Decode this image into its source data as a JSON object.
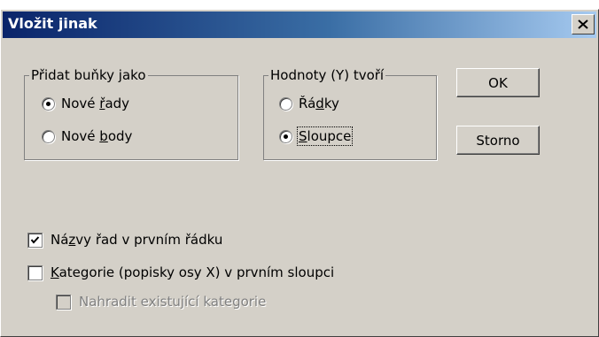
{
  "dialog": {
    "title": "Vložit jinak",
    "close_icon": "close-icon"
  },
  "add_cells_group": {
    "legend": "Přidat buňky jako",
    "options": [
      {
        "label_pre": "Nové ",
        "label_mn": "ř",
        "label_post": "ady",
        "checked": true
      },
      {
        "label_pre": "Nové ",
        "label_mn": "b",
        "label_post": "ody",
        "checked": false
      }
    ]
  },
  "values_group": {
    "legend": "Hodnoty (Y) tvoří",
    "options": [
      {
        "label_pre": "Řá",
        "label_mn": "d",
        "label_post": "ky",
        "checked": false
      },
      {
        "label_pre": "",
        "label_mn": "S",
        "label_post": "loupce",
        "checked": true
      }
    ]
  },
  "buttons": {
    "ok": "OK",
    "cancel": "Storno"
  },
  "checkboxes": [
    {
      "label_pre": "Ná",
      "label_mn": "z",
      "label_post": "vy řad v prvním řádku",
      "checked": true,
      "disabled": false
    },
    {
      "label_pre": "",
      "label_mn": "K",
      "label_post": "ategorie (popisky osy X) v prvním sloupci",
      "checked": false,
      "disabled": false
    },
    {
      "label_pre": "Nahradit existující kategorie",
      "label_mn": "",
      "label_post": "",
      "checked": false,
      "disabled": true
    }
  ]
}
